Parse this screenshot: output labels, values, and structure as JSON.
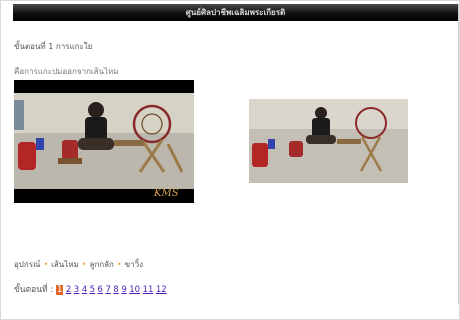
{
  "header": {
    "title": "ศูนย์ศิลปาชีพเฉลิมพระเกียรติ"
  },
  "lesson": {
    "step_title": "ขั้นตอนที่ 1 การแกะใย",
    "subtitle": "คือการแกะปมออกจากเส้นไหม"
  },
  "videos": [
    {
      "name": "lesson-video-main",
      "watermark": "KMS"
    },
    {
      "name": "lesson-video-thumbnail"
    }
  ],
  "caption": {
    "items": [
      "อุปกรณ์",
      "เส้นไหม",
      "ลูกกลัก",
      "ขาวิ้ง"
    ],
    "separator": "•"
  },
  "steps": {
    "label": "ขั้นตอนที่ :",
    "pages": [
      "1",
      "2",
      "3",
      "4",
      "5",
      "6",
      "7",
      "8",
      "9",
      "10",
      "11",
      "12"
    ],
    "current": "1"
  },
  "colors": {
    "accent_orange": "#e2682a",
    "link": "#4a1fb8",
    "separator": "#e7a64a"
  }
}
